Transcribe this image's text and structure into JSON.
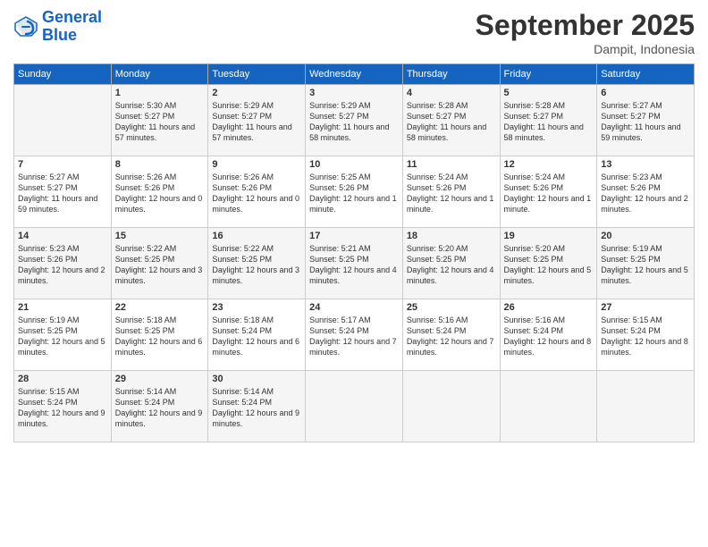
{
  "logo": {
    "line1": "General",
    "line2": "Blue"
  },
  "title": "September 2025",
  "location": "Dampit, Indonesia",
  "weekdays": [
    "Sunday",
    "Monday",
    "Tuesday",
    "Wednesday",
    "Thursday",
    "Friday",
    "Saturday"
  ],
  "weeks": [
    [
      {
        "day": "",
        "sunrise": "",
        "sunset": "",
        "daylight": ""
      },
      {
        "day": "1",
        "sunrise": "Sunrise: 5:30 AM",
        "sunset": "Sunset: 5:27 PM",
        "daylight": "Daylight: 11 hours and 57 minutes."
      },
      {
        "day": "2",
        "sunrise": "Sunrise: 5:29 AM",
        "sunset": "Sunset: 5:27 PM",
        "daylight": "Daylight: 11 hours and 57 minutes."
      },
      {
        "day": "3",
        "sunrise": "Sunrise: 5:29 AM",
        "sunset": "Sunset: 5:27 PM",
        "daylight": "Daylight: 11 hours and 58 minutes."
      },
      {
        "day": "4",
        "sunrise": "Sunrise: 5:28 AM",
        "sunset": "Sunset: 5:27 PM",
        "daylight": "Daylight: 11 hours and 58 minutes."
      },
      {
        "day": "5",
        "sunrise": "Sunrise: 5:28 AM",
        "sunset": "Sunset: 5:27 PM",
        "daylight": "Daylight: 11 hours and 58 minutes."
      },
      {
        "day": "6",
        "sunrise": "Sunrise: 5:27 AM",
        "sunset": "Sunset: 5:27 PM",
        "daylight": "Daylight: 11 hours and 59 minutes."
      }
    ],
    [
      {
        "day": "7",
        "sunrise": "Sunrise: 5:27 AM",
        "sunset": "Sunset: 5:27 PM",
        "daylight": "Daylight: 11 hours and 59 minutes."
      },
      {
        "day": "8",
        "sunrise": "Sunrise: 5:26 AM",
        "sunset": "Sunset: 5:26 PM",
        "daylight": "Daylight: 12 hours and 0 minutes."
      },
      {
        "day": "9",
        "sunrise": "Sunrise: 5:26 AM",
        "sunset": "Sunset: 5:26 PM",
        "daylight": "Daylight: 12 hours and 0 minutes."
      },
      {
        "day": "10",
        "sunrise": "Sunrise: 5:25 AM",
        "sunset": "Sunset: 5:26 PM",
        "daylight": "Daylight: 12 hours and 1 minute."
      },
      {
        "day": "11",
        "sunrise": "Sunrise: 5:24 AM",
        "sunset": "Sunset: 5:26 PM",
        "daylight": "Daylight: 12 hours and 1 minute."
      },
      {
        "day": "12",
        "sunrise": "Sunrise: 5:24 AM",
        "sunset": "Sunset: 5:26 PM",
        "daylight": "Daylight: 12 hours and 1 minute."
      },
      {
        "day": "13",
        "sunrise": "Sunrise: 5:23 AM",
        "sunset": "Sunset: 5:26 PM",
        "daylight": "Daylight: 12 hours and 2 minutes."
      }
    ],
    [
      {
        "day": "14",
        "sunrise": "Sunrise: 5:23 AM",
        "sunset": "Sunset: 5:26 PM",
        "daylight": "Daylight: 12 hours and 2 minutes."
      },
      {
        "day": "15",
        "sunrise": "Sunrise: 5:22 AM",
        "sunset": "Sunset: 5:25 PM",
        "daylight": "Daylight: 12 hours and 3 minutes."
      },
      {
        "day": "16",
        "sunrise": "Sunrise: 5:22 AM",
        "sunset": "Sunset: 5:25 PM",
        "daylight": "Daylight: 12 hours and 3 minutes."
      },
      {
        "day": "17",
        "sunrise": "Sunrise: 5:21 AM",
        "sunset": "Sunset: 5:25 PM",
        "daylight": "Daylight: 12 hours and 4 minutes."
      },
      {
        "day": "18",
        "sunrise": "Sunrise: 5:20 AM",
        "sunset": "Sunset: 5:25 PM",
        "daylight": "Daylight: 12 hours and 4 minutes."
      },
      {
        "day": "19",
        "sunrise": "Sunrise: 5:20 AM",
        "sunset": "Sunset: 5:25 PM",
        "daylight": "Daylight: 12 hours and 5 minutes."
      },
      {
        "day": "20",
        "sunrise": "Sunrise: 5:19 AM",
        "sunset": "Sunset: 5:25 PM",
        "daylight": "Daylight: 12 hours and 5 minutes."
      }
    ],
    [
      {
        "day": "21",
        "sunrise": "Sunrise: 5:19 AM",
        "sunset": "Sunset: 5:25 PM",
        "daylight": "Daylight: 12 hours and 5 minutes."
      },
      {
        "day": "22",
        "sunrise": "Sunrise: 5:18 AM",
        "sunset": "Sunset: 5:25 PM",
        "daylight": "Daylight: 12 hours and 6 minutes."
      },
      {
        "day": "23",
        "sunrise": "Sunrise: 5:18 AM",
        "sunset": "Sunset: 5:24 PM",
        "daylight": "Daylight: 12 hours and 6 minutes."
      },
      {
        "day": "24",
        "sunrise": "Sunrise: 5:17 AM",
        "sunset": "Sunset: 5:24 PM",
        "daylight": "Daylight: 12 hours and 7 minutes."
      },
      {
        "day": "25",
        "sunrise": "Sunrise: 5:16 AM",
        "sunset": "Sunset: 5:24 PM",
        "daylight": "Daylight: 12 hours and 7 minutes."
      },
      {
        "day": "26",
        "sunrise": "Sunrise: 5:16 AM",
        "sunset": "Sunset: 5:24 PM",
        "daylight": "Daylight: 12 hours and 8 minutes."
      },
      {
        "day": "27",
        "sunrise": "Sunrise: 5:15 AM",
        "sunset": "Sunset: 5:24 PM",
        "daylight": "Daylight: 12 hours and 8 minutes."
      }
    ],
    [
      {
        "day": "28",
        "sunrise": "Sunrise: 5:15 AM",
        "sunset": "Sunset: 5:24 PM",
        "daylight": "Daylight: 12 hours and 9 minutes."
      },
      {
        "day": "29",
        "sunrise": "Sunrise: 5:14 AM",
        "sunset": "Sunset: 5:24 PM",
        "daylight": "Daylight: 12 hours and 9 minutes."
      },
      {
        "day": "30",
        "sunrise": "Sunrise: 5:14 AM",
        "sunset": "Sunset: 5:24 PM",
        "daylight": "Daylight: 12 hours and 9 minutes."
      },
      {
        "day": "",
        "sunrise": "",
        "sunset": "",
        "daylight": ""
      },
      {
        "day": "",
        "sunrise": "",
        "sunset": "",
        "daylight": ""
      },
      {
        "day": "",
        "sunrise": "",
        "sunset": "",
        "daylight": ""
      },
      {
        "day": "",
        "sunrise": "",
        "sunset": "",
        "daylight": ""
      }
    ]
  ]
}
